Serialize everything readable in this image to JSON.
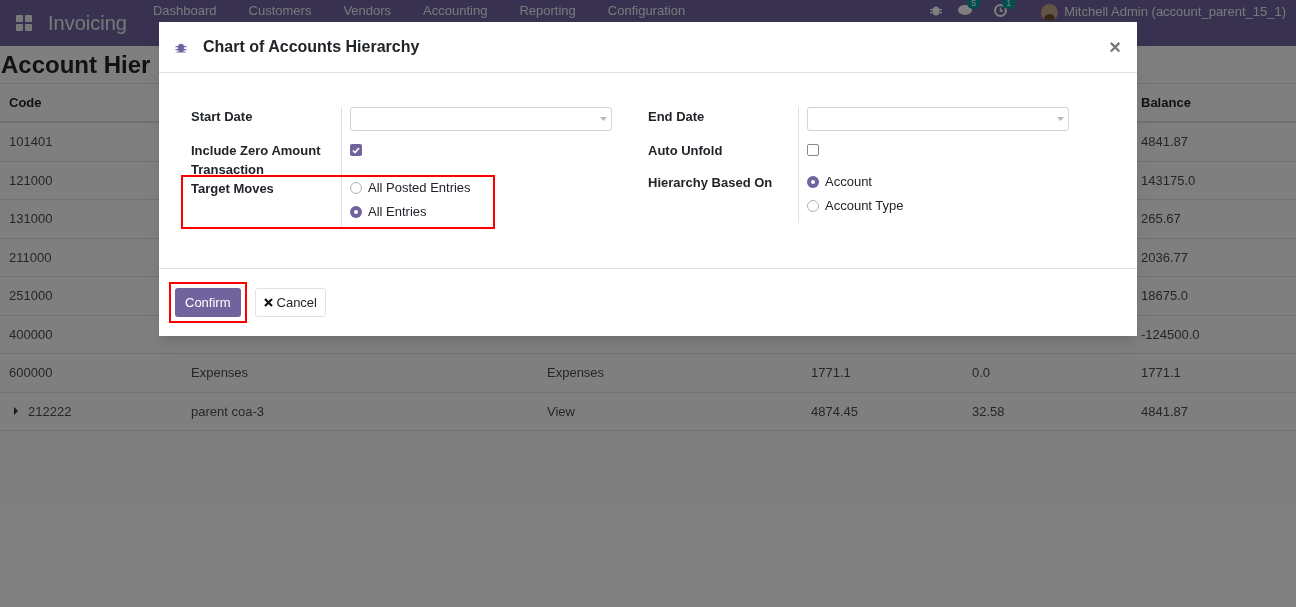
{
  "navbar": {
    "app": "Invoicing",
    "menu": [
      "Dashboard",
      "Customers",
      "Vendors",
      "Accounting",
      "Reporting",
      "Configuration"
    ],
    "messages_badge": "5",
    "activities_badge": "1",
    "user": "Mitchell Admin (account_parent_15_1)"
  },
  "page_title": "Account Hier",
  "table": {
    "headers": {
      "code": "Code",
      "balance": "Balance"
    },
    "rows": [
      {
        "code": "101401",
        "balance": "4841.87"
      },
      {
        "code": "121000",
        "balance": "143175.0"
      },
      {
        "code": "131000",
        "balance": "265.67"
      },
      {
        "code": "211000",
        "balance": "2036.77"
      },
      {
        "code": "251000",
        "balance": "18675.0"
      },
      {
        "code": "400000",
        "balance": "-124500.0"
      },
      {
        "code": "600000",
        "name": "Expenses",
        "type": "Expenses",
        "debit": "1771.1",
        "credit": "0.0",
        "balance": "1771.1"
      },
      {
        "code": "212222",
        "expanded": false,
        "name": "parent coa-3",
        "type": "View",
        "debit": "4874.45",
        "credit": "32.58",
        "balance": "4841.87"
      }
    ]
  },
  "dialog": {
    "title": "Chart of Accounts Hierarchy",
    "close": "×",
    "left_fields": [
      {
        "kind": "date",
        "label": "Start Date",
        "highlighted": false
      },
      {
        "kind": "checkbox",
        "label": "Include Zero Amount Transaction",
        "checked": true,
        "highlighted": false
      },
      {
        "kind": "radio",
        "label": "Target Moves",
        "highlighted": true,
        "options": [
          {
            "label": "All Posted Entries",
            "selected": false
          },
          {
            "label": "All Entries",
            "selected": true
          }
        ]
      }
    ],
    "right_fields": [
      {
        "kind": "date",
        "label": "End Date",
        "highlighted": false
      },
      {
        "kind": "checkbox",
        "label": "Auto Unfold",
        "checked": false,
        "highlighted": false
      },
      {
        "kind": "radio",
        "label": "Hierarchy Based On",
        "highlighted": false,
        "options": [
          {
            "label": "Account",
            "selected": true
          },
          {
            "label": "Account Type",
            "selected": false
          }
        ]
      }
    ],
    "buttons": [
      {
        "kind": "primary",
        "label": "Confirm",
        "highlighted": true
      },
      {
        "kind": "cancel",
        "label": "Cancel",
        "highlighted": false
      }
    ]
  }
}
